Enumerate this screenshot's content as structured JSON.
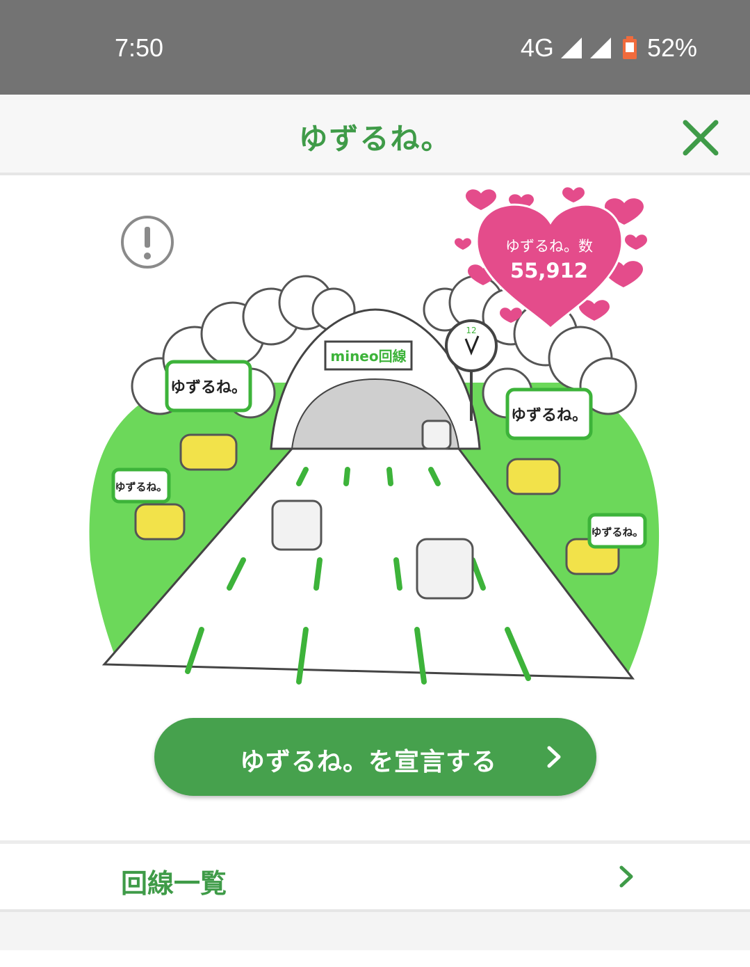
{
  "status_bar": {
    "time": "7:50",
    "network": "4G",
    "battery": "52%"
  },
  "app_bar": {
    "title": "ゆずるね。"
  },
  "heart_badge": {
    "label": "ゆずるね。数",
    "count": "55,912"
  },
  "illustration": {
    "bubbles": [
      "ゆずるね。",
      "ゆずるね。",
      "ゆずるね。",
      "ゆずるね。"
    ],
    "tunnel_sign": "mineo回線",
    "clock_number": "12"
  },
  "cta": {
    "label": "ゆずるね。を宣言する"
  },
  "list": {
    "item_label": "回線一覧"
  },
  "colors": {
    "brand_green": "#3f9b48",
    "button_green": "#46a14d",
    "heart_pink": "#e44c8b",
    "grass_green": "#6cd85a"
  }
}
